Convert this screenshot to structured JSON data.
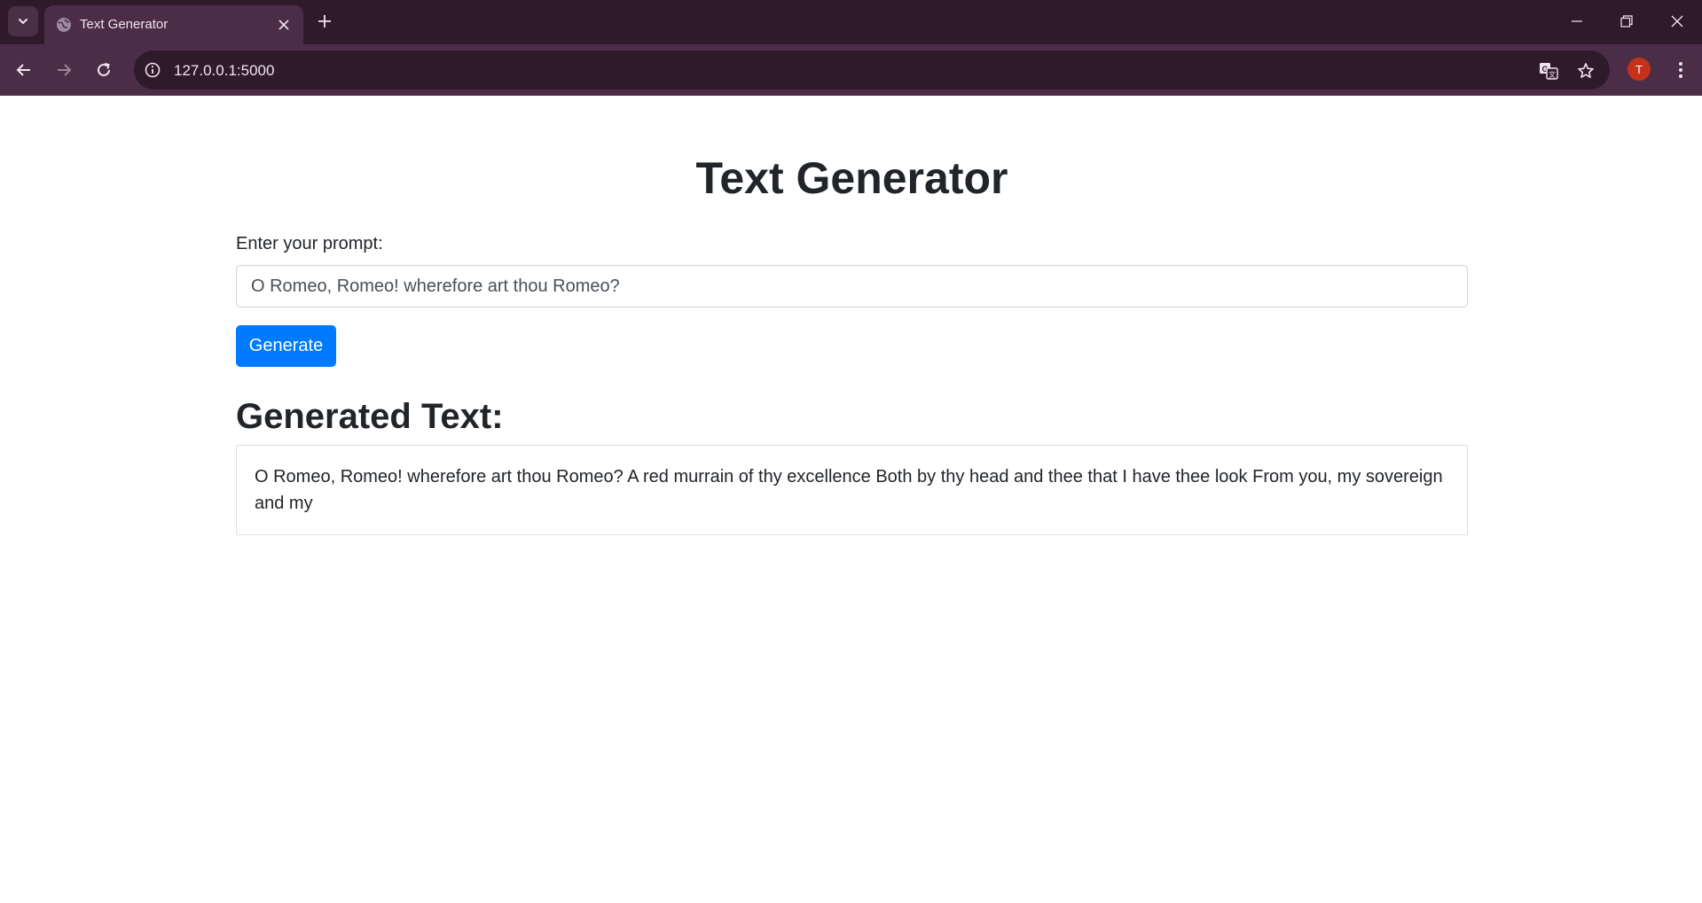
{
  "browser": {
    "tab_title": "Text Generator",
    "url": "127.0.0.1:5000",
    "profile_initial": "T",
    "accent_colors": {
      "frame": "#2f1a2c",
      "toolbar": "#4b2d47",
      "avatar": "#c4321a"
    }
  },
  "page": {
    "title": "Text Generator",
    "prompt_label": "Enter your prompt:",
    "prompt_value": "O Romeo, Romeo! wherefore art thou Romeo?",
    "generate_label": "Generate",
    "result_heading": "Generated Text:",
    "result_text": "O Romeo, Romeo! wherefore art thou Romeo? A red murrain of thy excellence Both by thy head and thee that I have thee look From you, my sovereign and my",
    "colors": {
      "button": "#007bff",
      "text": "#212529"
    }
  },
  "icons": {
    "tab_list": "chevron-down-icon",
    "favicon": "globe-icon",
    "tab_close": "close-icon",
    "new_tab": "plus-icon",
    "back": "arrow-left-icon",
    "forward": "arrow-right-icon",
    "reload": "reload-icon",
    "site_info": "info-icon",
    "translate": "translate-icon",
    "bookmark": "star-icon",
    "menu": "kebab-menu-icon"
  }
}
